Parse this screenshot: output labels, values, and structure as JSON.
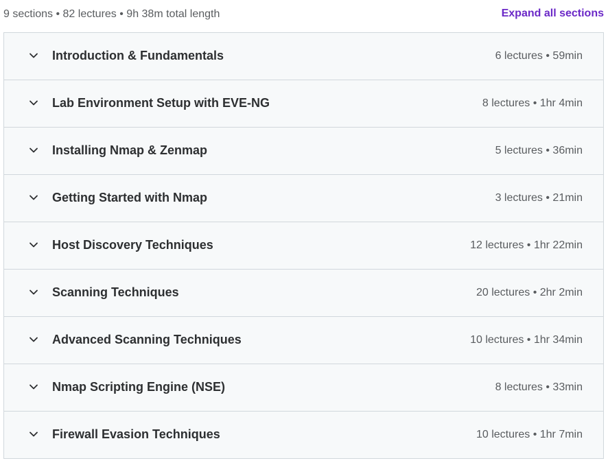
{
  "summary": "9 sections • 82 lectures • 9h 38m total length",
  "expand_all_label": "Expand all sections",
  "colors": {
    "accent": "#6b28c7",
    "section_bg": "#f7f9fa",
    "border": "#d1d7dc",
    "text": "#2d2f31",
    "muted_text": "#595c5f"
  },
  "sections": [
    {
      "title": "Introduction & Fundamentals",
      "meta": "6 lectures • 59min",
      "icon": "chevron-down-icon"
    },
    {
      "title": "Lab Environment Setup with EVE-NG",
      "meta": "8 lectures • 1hr 4min",
      "icon": "chevron-down-icon"
    },
    {
      "title": "Installing Nmap & Zenmap",
      "meta": "5 lectures • 36min",
      "icon": "chevron-down-icon"
    },
    {
      "title": "Getting Started with Nmap",
      "meta": "3 lectures • 21min",
      "icon": "chevron-down-icon"
    },
    {
      "title": "Host Discovery Techniques",
      "meta": "12 lectures • 1hr 22min",
      "icon": "chevron-down-icon"
    },
    {
      "title": "Scanning Techniques",
      "meta": "20 lectures • 2hr 2min",
      "icon": "chevron-down-icon"
    },
    {
      "title": "Advanced Scanning Techniques",
      "meta": "10 lectures • 1hr 34min",
      "icon": "chevron-down-icon"
    },
    {
      "title": "Nmap Scripting Engine (NSE)",
      "meta": "8 lectures • 33min",
      "icon": "chevron-down-icon"
    },
    {
      "title": "Firewall Evasion Techniques",
      "meta": "10 lectures • 1hr 7min",
      "icon": "chevron-down-icon"
    }
  ]
}
